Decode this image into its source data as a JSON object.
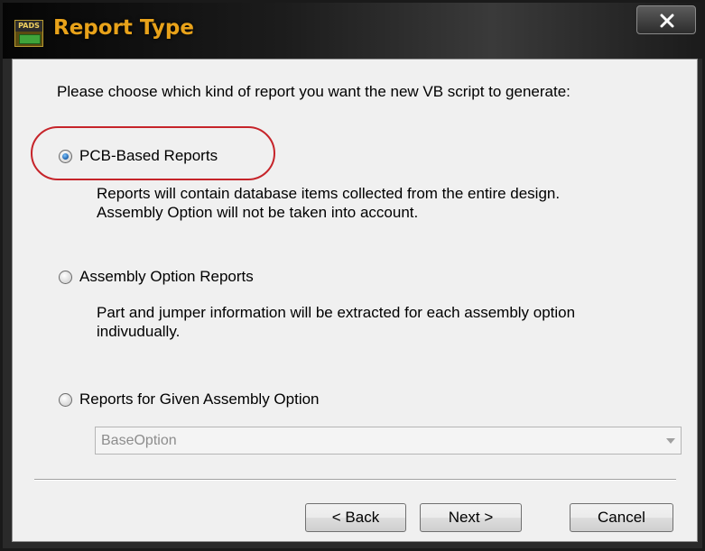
{
  "window": {
    "title": "Report Type",
    "app_icon_text": "PADS",
    "close_glyph": "x"
  },
  "dialog": {
    "prompt": "Please choose which kind of report you want the new VB script to generate:",
    "options": [
      {
        "label": "PCB-Based Reports",
        "checked": true,
        "description_lines": [
          "Reports will contain database items collected from the entire design.",
          "Assembly Option will not be taken into account."
        ]
      },
      {
        "label": "Assembly Option Reports",
        "checked": false,
        "description_lines": [
          "Part and jumper information will be extracted for each assembly option",
          "indivudually."
        ]
      },
      {
        "label": "Reports for Given Assembly Option",
        "checked": false,
        "description_lines": []
      }
    ],
    "assembly_option_select": {
      "value": "BaseOption",
      "disabled": true
    }
  },
  "buttons": {
    "back": "< Back",
    "next": "Next >",
    "cancel": "Cancel"
  },
  "colors": {
    "title_text": "#e8a21a",
    "highlight_annotation": "#c6242a"
  }
}
